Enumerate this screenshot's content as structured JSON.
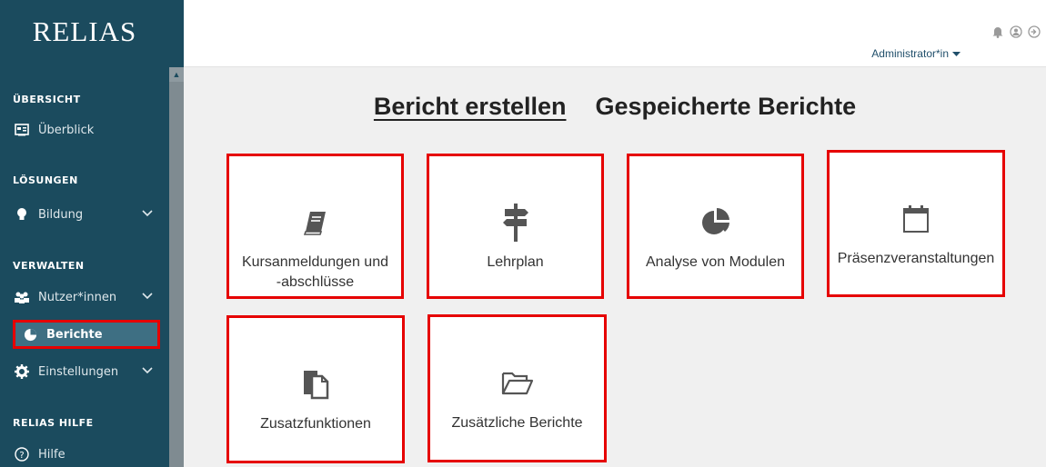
{
  "app": {
    "logo_text": "RELIAS"
  },
  "sidebar": {
    "sections": [
      {
        "label": "ÜBERSICHT"
      },
      {
        "label": "LÖSUNGEN"
      },
      {
        "label": "VERWALTEN"
      },
      {
        "label": "RELIAS HILFE"
      }
    ],
    "items": [
      {
        "label": "Überblick",
        "icon": "dashboard-icon"
      },
      {
        "label": "Bildung",
        "icon": "lightbulb-icon"
      },
      {
        "label": "Nutzer*innen",
        "icon": "users-icon"
      },
      {
        "label": "Berichte",
        "icon": "pie-chart-icon",
        "active": true
      },
      {
        "label": "Einstellungen",
        "icon": "gear-icon"
      },
      {
        "label": "Hilfe",
        "icon": "help-icon"
      }
    ]
  },
  "header": {
    "user_label": "Administrator*in"
  },
  "main": {
    "tabs": [
      {
        "label": "Bericht erstellen",
        "active": true
      },
      {
        "label": "Gespeicherte Berichte",
        "active": false
      }
    ],
    "cards": [
      {
        "label_line1": "Kursanmeldungen und",
        "label_line2": "-abschlüsse",
        "icon": "book-icon"
      },
      {
        "label": "Lehrplan",
        "icon": "signpost-icon"
      },
      {
        "label": "Analyse von Modulen",
        "icon": "pie-chart-icon"
      },
      {
        "label": "Präsenzveranstaltungen",
        "icon": "calendar-icon"
      },
      {
        "label": "Zusatzfunktionen",
        "icon": "documents-icon"
      },
      {
        "label": "Zusätzliche Berichte",
        "icon": "folder-open-icon"
      }
    ]
  },
  "colors": {
    "sidebar_bg": "#1b4b5e",
    "highlight": "#e60000",
    "content_bg": "#f0f0f0",
    "icon_gray": "#555555"
  }
}
